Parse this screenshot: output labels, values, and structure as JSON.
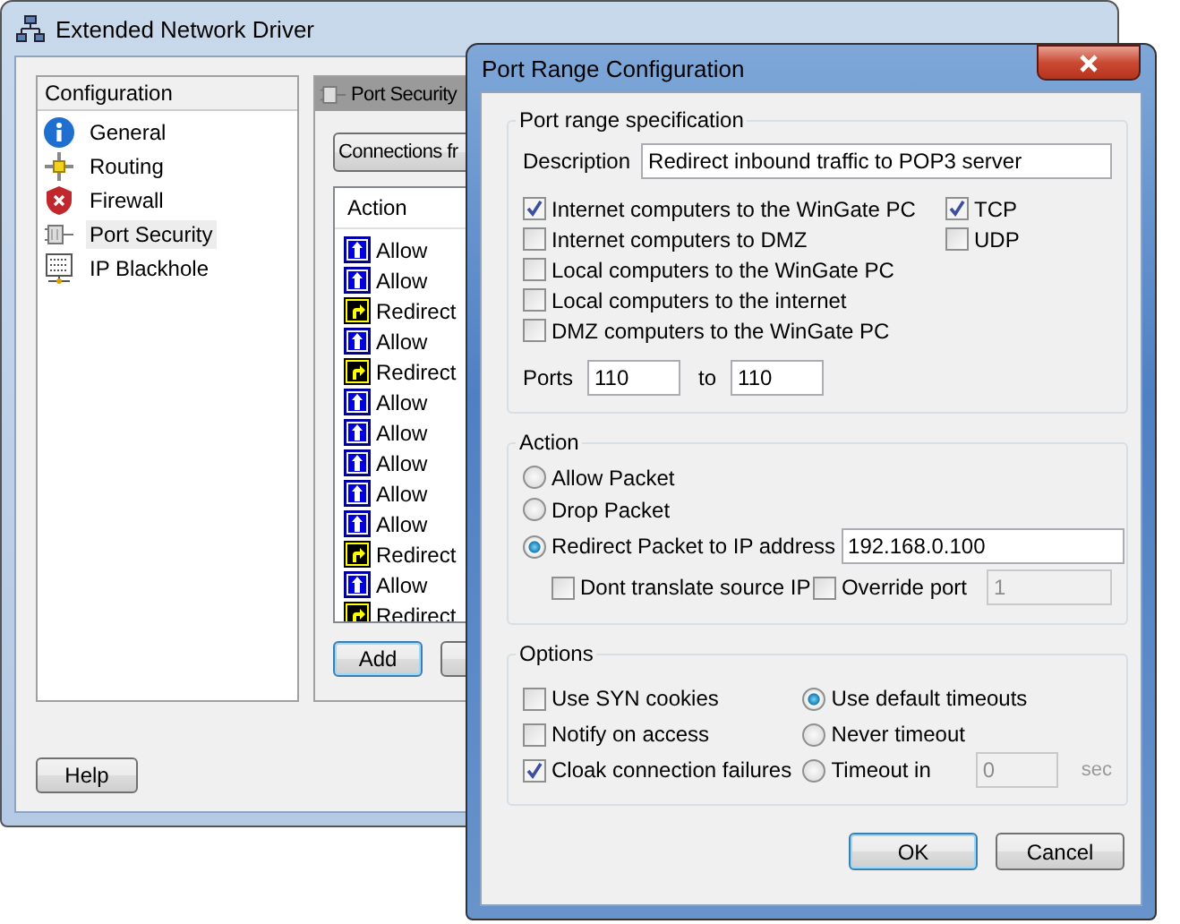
{
  "main_window": {
    "title": "Extended Network Driver",
    "sidebar": {
      "header": "Configuration",
      "items": [
        {
          "label": "General",
          "selected": false
        },
        {
          "label": "Routing",
          "selected": false
        },
        {
          "label": "Firewall",
          "selected": false
        },
        {
          "label": "Port Security",
          "selected": true
        },
        {
          "label": "IP Blackhole",
          "selected": false
        }
      ]
    },
    "panel": {
      "title": "Port Security",
      "filter_button": "Connections fr",
      "table": {
        "columns": [
          "Action"
        ],
        "rows": [
          {
            "kind": "allow",
            "action": "Allow"
          },
          {
            "kind": "allow",
            "action": "Allow"
          },
          {
            "kind": "redirect",
            "action": "Redirect"
          },
          {
            "kind": "allow",
            "action": "Allow"
          },
          {
            "kind": "redirect",
            "action": "Redirect"
          },
          {
            "kind": "allow",
            "action": "Allow"
          },
          {
            "kind": "allow",
            "action": "Allow"
          },
          {
            "kind": "allow",
            "action": "Allow"
          },
          {
            "kind": "allow",
            "action": "Allow"
          },
          {
            "kind": "allow",
            "action": "Allow"
          },
          {
            "kind": "redirect",
            "action": "Redirect"
          },
          {
            "kind": "allow",
            "action": "Allow"
          },
          {
            "kind": "redirect",
            "action": "Redirect"
          }
        ]
      },
      "add_button": "Add"
    },
    "help_button": "Help"
  },
  "dialog": {
    "title": "Port Range Configuration",
    "port_range": {
      "legend": "Port range specification",
      "description_label": "Description",
      "description_value": "Redirect inbound traffic to POP3 server",
      "directions": [
        {
          "label": "Internet computers to the WinGate PC",
          "checked": true
        },
        {
          "label": "Internet computers to DMZ",
          "checked": false
        },
        {
          "label": "Local computers to the WinGate PC",
          "checked": false
        },
        {
          "label": "Local computers to the internet",
          "checked": false
        },
        {
          "label": "DMZ computers to the WinGate PC",
          "checked": false
        }
      ],
      "protocols": [
        {
          "label": "TCP",
          "checked": true
        },
        {
          "label": "UDP",
          "checked": false
        }
      ],
      "ports_label": "Ports",
      "port_from": "110",
      "to_label": "to",
      "port_to": "110"
    },
    "action": {
      "legend": "Action",
      "choices": [
        {
          "label": "Allow Packet",
          "selected": false
        },
        {
          "label": "Drop Packet",
          "selected": false
        },
        {
          "label": "Redirect Packet to IP address",
          "selected": true
        }
      ],
      "redirect_ip": "192.168.0.100",
      "dont_translate": {
        "label": "Dont translate source IP",
        "checked": false
      },
      "override_port": {
        "label": "Override port",
        "checked": false,
        "value": "1",
        "disabled": true
      }
    },
    "options": {
      "legend": "Options",
      "checks": [
        {
          "label": "Use SYN cookies",
          "checked": false
        },
        {
          "label": "Notify on access",
          "checked": false
        },
        {
          "label": "Cloak connection failures",
          "checked": true
        }
      ],
      "timeouts": [
        {
          "label": "Use default timeouts",
          "selected": true
        },
        {
          "label": "Never timeout",
          "selected": false
        },
        {
          "label": "Timeout in",
          "selected": false
        }
      ],
      "timeout_value": "0",
      "timeout_disabled": true,
      "timeout_unit": "sec"
    },
    "buttons": [
      {
        "label": "OK",
        "default": true
      },
      {
        "label": "Cancel",
        "default": false
      }
    ]
  }
}
